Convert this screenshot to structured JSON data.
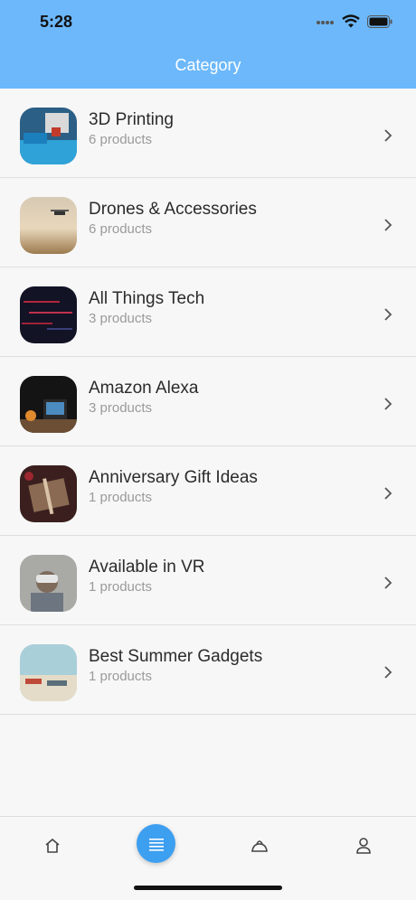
{
  "status": {
    "time": "5:28"
  },
  "header": {
    "title": "Category"
  },
  "categories": [
    {
      "name": "3D Printing",
      "count": "6 products"
    },
    {
      "name": "Drones & Accessories",
      "count": "6 products"
    },
    {
      "name": "All Things Tech",
      "count": "3 products"
    },
    {
      "name": "Amazon Alexa",
      "count": "3 products"
    },
    {
      "name": "Anniversary Gift Ideas",
      "count": "1 products"
    },
    {
      "name": "Available in VR",
      "count": "1 products"
    },
    {
      "name": "Best Summer Gadgets",
      "count": "1 products"
    }
  ],
  "tabbar": {
    "items": [
      "home-icon",
      "list-icon",
      "bag-icon",
      "profile-icon"
    ],
    "active_color": "#3d9ff0"
  },
  "colors": {
    "header": "#6cb8fb",
    "background": "#f7f7f7"
  }
}
